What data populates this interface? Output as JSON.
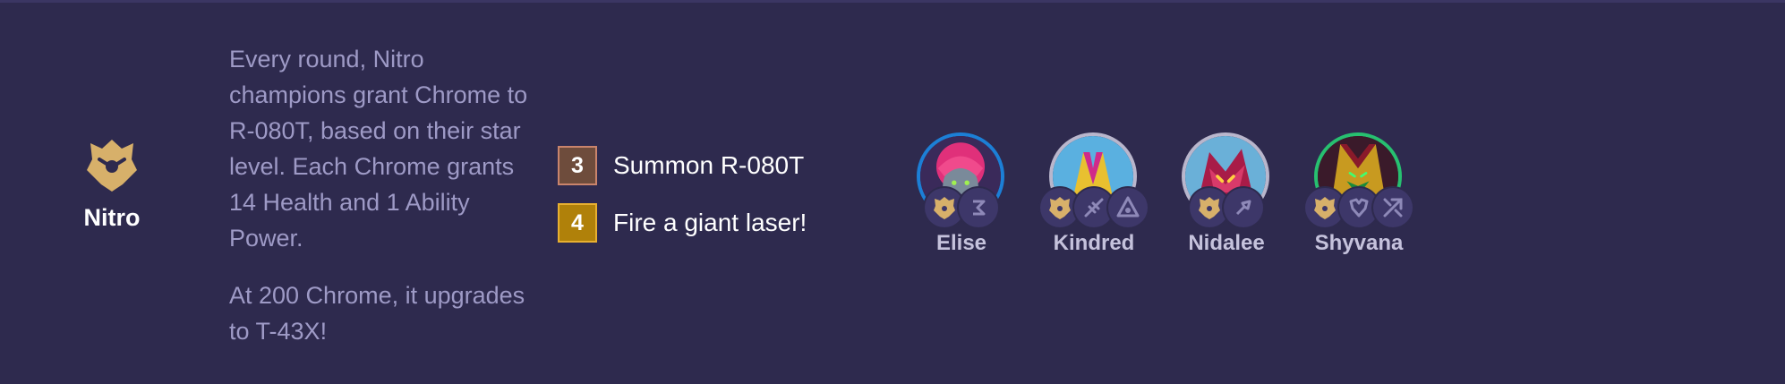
{
  "trait": {
    "name": "Nitro",
    "icon": "nitro-trait-icon",
    "color": "#d7b06a"
  },
  "description": {
    "paragraph_1": "Every round, Nitro champions grant Chrome to R-080T, based on their star level. Each Chrome grants 14 Health and 1 Ability Power.",
    "paragraph_2": "At 200 Chrome, it upgrades to T-43X!"
  },
  "breakpoints": [
    {
      "count": "3",
      "label": "Summon R-080T",
      "tier": "bronze"
    },
    {
      "count": "4",
      "label": "Fire a giant laser!",
      "tier": "gold"
    }
  ],
  "champions": [
    {
      "name": "Elise",
      "frame_color": "#1c7fd6",
      "portrait": "elise-portrait",
      "traits": [
        "nitro-icon",
        "bastion-icon"
      ]
    },
    {
      "name": "Kindred",
      "frame_color": "#b9b6cc",
      "portrait": "kindred-portrait",
      "traits": [
        "nitro-icon",
        "rapidfire-icon",
        "techie-icon"
      ]
    },
    {
      "name": "Nidalee",
      "frame_color": "#b9b6cc",
      "portrait": "nidalee-portrait",
      "traits": [
        "nitro-icon",
        "amp-icon"
      ]
    },
    {
      "name": "Shyvana",
      "frame_color": "#27c070",
      "portrait": "shyvana-portrait",
      "traits": [
        "nitro-icon",
        "bruiser-icon",
        "marksman-icon"
      ]
    }
  ]
}
